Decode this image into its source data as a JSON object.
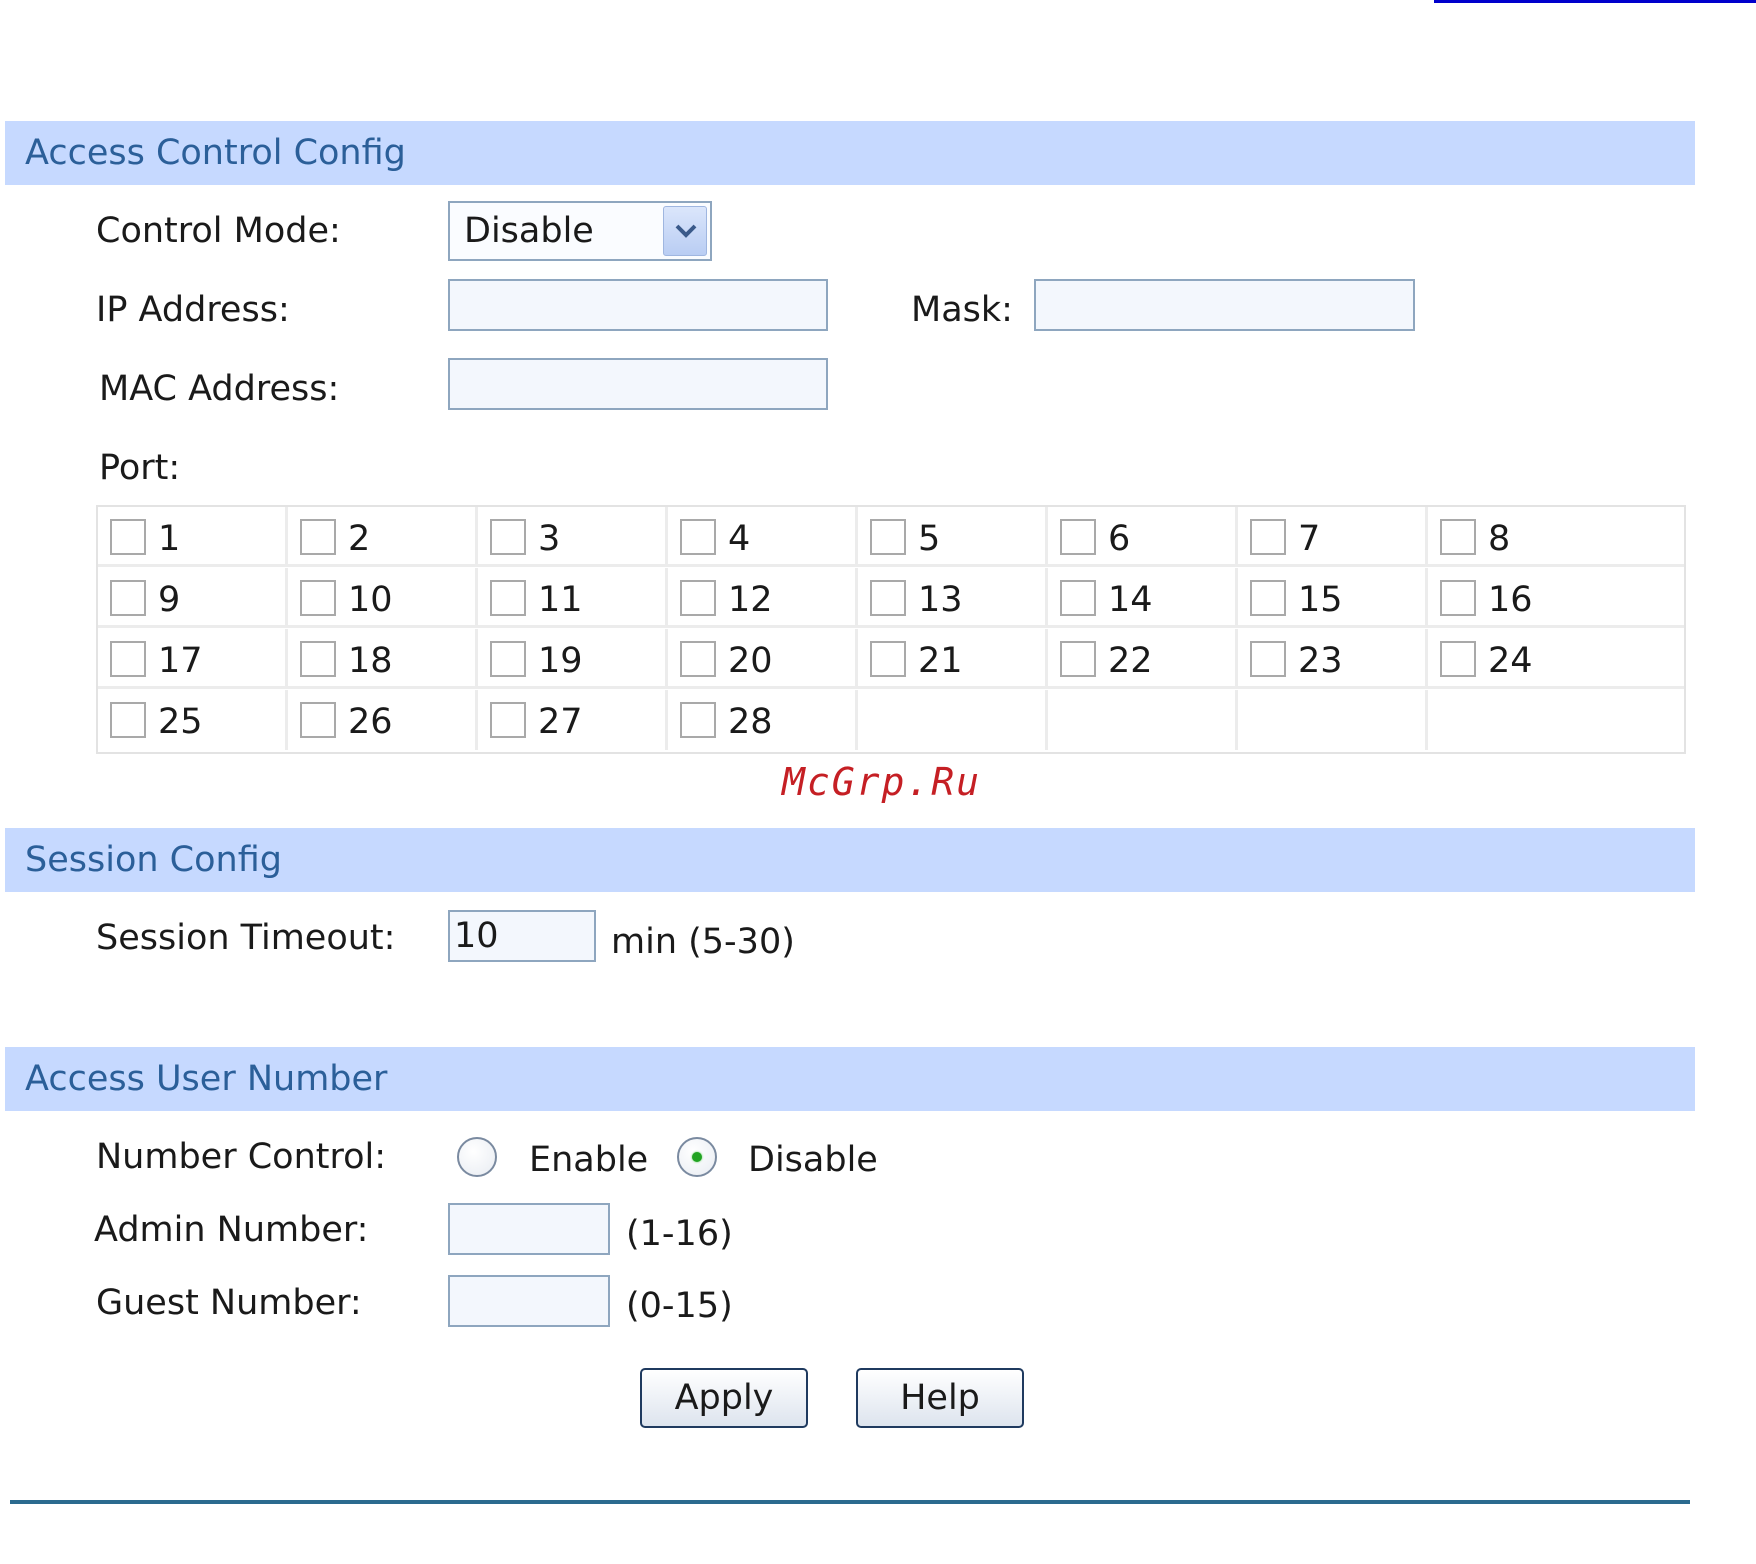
{
  "access_control": {
    "title": "Access Control Config",
    "control_mode_label": "Control Mode:",
    "control_mode_value": "Disable",
    "ip_label": "IP Address:",
    "ip_value": "",
    "mask_label": "Mask:",
    "mask_value": "",
    "mac_label": "MAC Address:",
    "mac_value": "",
    "port_label": "Port:",
    "ports": [
      "1",
      "2",
      "3",
      "4",
      "5",
      "6",
      "7",
      "8",
      "9",
      "10",
      "11",
      "12",
      "13",
      "14",
      "15",
      "16",
      "17",
      "18",
      "19",
      "20",
      "21",
      "22",
      "23",
      "24",
      "25",
      "26",
      "27",
      "28"
    ]
  },
  "watermark": "McGrp.Ru",
  "session": {
    "title": "Session Config",
    "timeout_label": "Session Timeout:",
    "timeout_value": "10",
    "timeout_unit": "min (5-30)"
  },
  "access_user": {
    "title": "Access User Number",
    "number_control_label": "Number Control:",
    "enable_label": "Enable",
    "disable_label": "Disable",
    "selected": "disable",
    "admin_label": "Admin Number:",
    "admin_value": "",
    "admin_range": "(1-16)",
    "guest_label": "Guest Number:",
    "guest_value": "",
    "guest_range": "(0-15)"
  },
  "buttons": {
    "apply_label": "Apply",
    "help_label": "Help"
  },
  "colors": {
    "header_bg": "#c6d9ff",
    "header_text": "#2b5f99",
    "watermark": "#c51f24",
    "radio_dot": "#21a321"
  }
}
